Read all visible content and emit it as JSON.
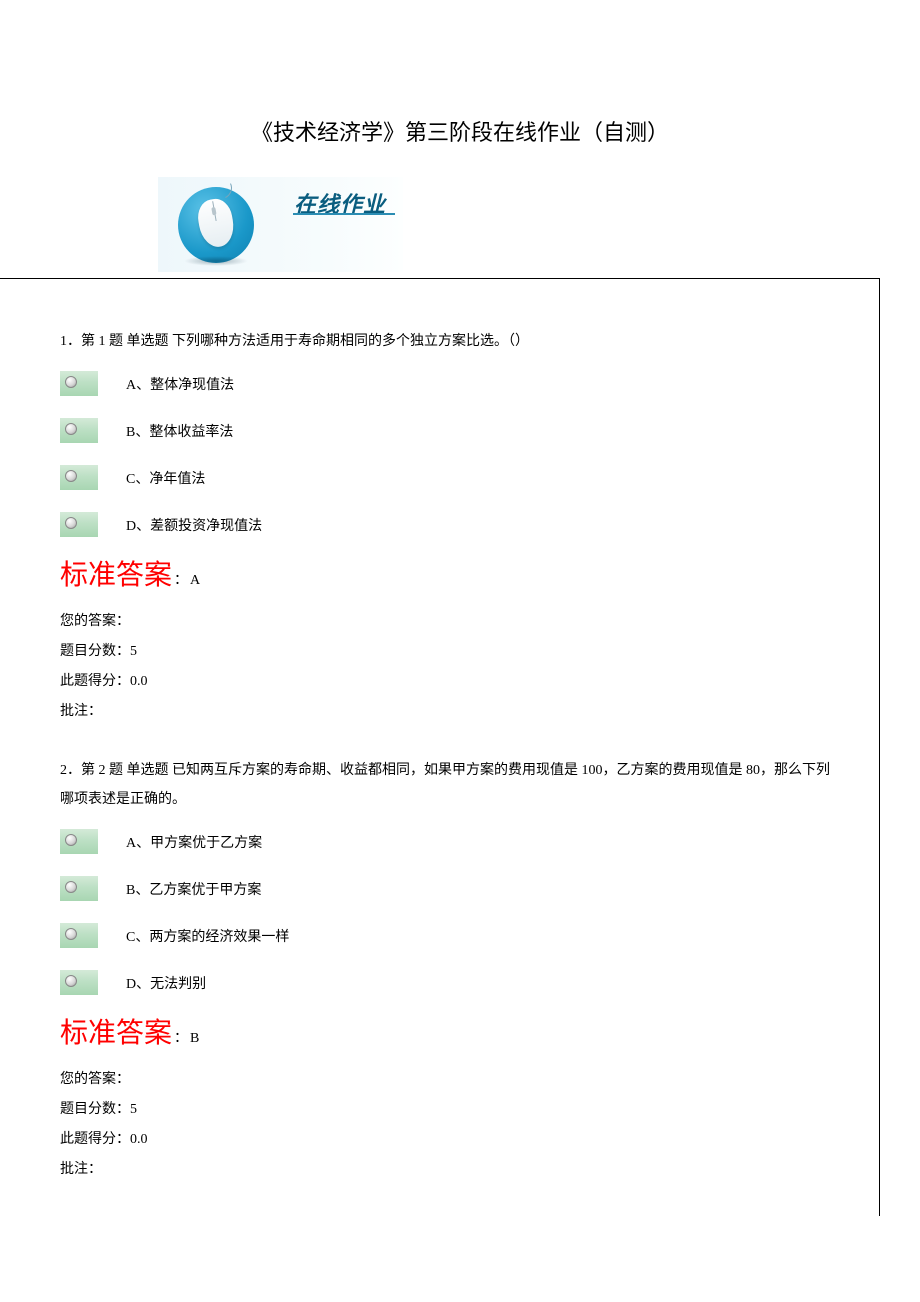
{
  "title": "《技术经济学》第三阶段在线作业（自测）",
  "banner_text": "在线作业",
  "labels": {
    "standard_answer": "标准答案",
    "your_answer": "您的答案：",
    "question_score": "题目分数：",
    "this_score": "此题得分：",
    "remark": "批注："
  },
  "questions": [
    {
      "stem": "1．第 1 题 单选题 下列哪种方法适用于寿命期相同的多个独立方案比选。（）",
      "options": [
        "A、整体净现值法",
        "B、整体收益率法",
        "C、净年值法",
        "D、差额投资净现值法"
      ],
      "standard_answer": "A",
      "your_answer": "",
      "question_score": "5",
      "this_score": "0.0",
      "remark": ""
    },
    {
      "stem": "2．第 2 题 单选题 已知两互斥方案的寿命期、收益都相同，如果甲方案的费用现值是 100，乙方案的费用现值是 80，那么下列哪项表述是正确的。",
      "options": [
        "A、甲方案优于乙方案",
        "B、乙方案优于甲方案",
        "C、两方案的经济效果一样",
        "D、无法判别"
      ],
      "standard_answer": "B",
      "your_answer": "",
      "question_score": "5",
      "this_score": "0.0",
      "remark": ""
    }
  ]
}
